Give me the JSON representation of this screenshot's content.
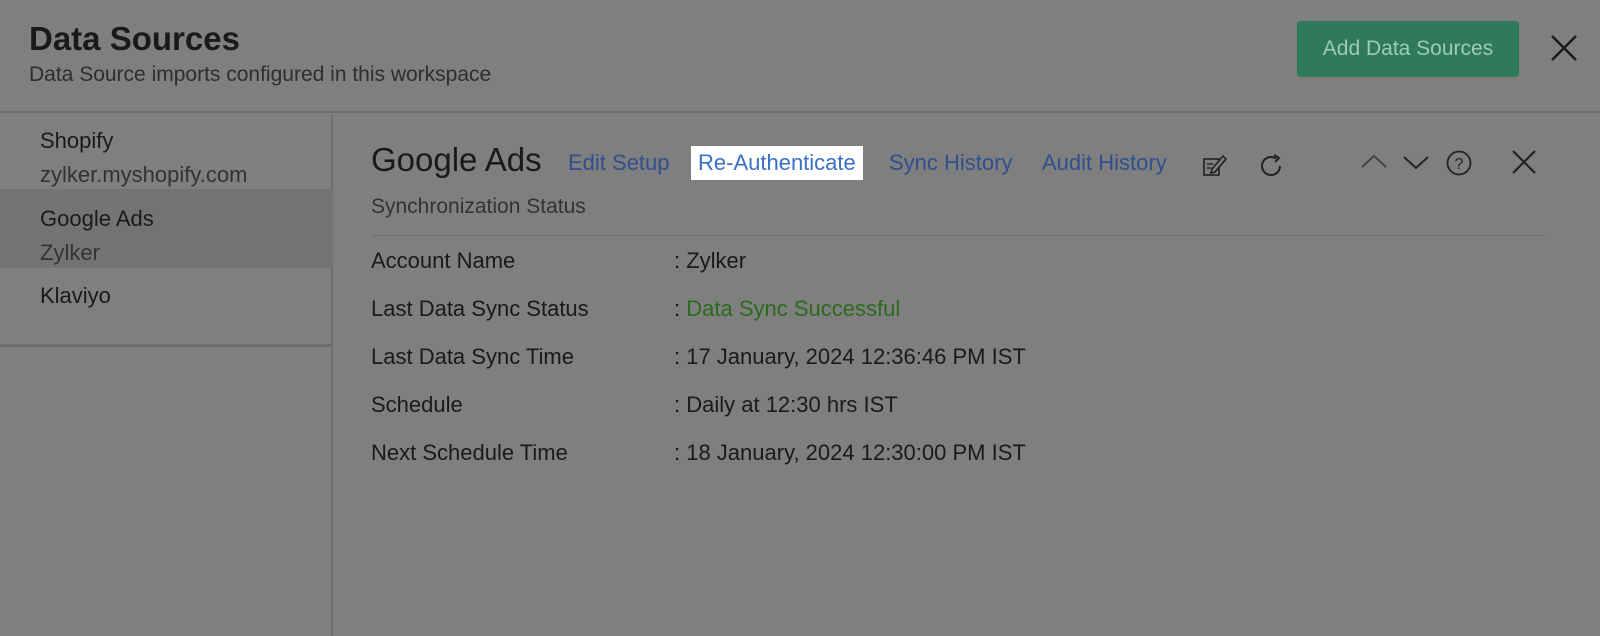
{
  "header": {
    "title": "Data Sources",
    "subtitle": "Data Source imports configured in this workspace",
    "add_button": "Add Data Sources"
  },
  "sidebar": {
    "items": [
      {
        "name": "Shopify",
        "sub": "zylker.myshopify.com"
      },
      {
        "name": "Google Ads",
        "sub": "Zylker",
        "active": true
      },
      {
        "name": "Klaviyo",
        "sub": ""
      }
    ]
  },
  "detail": {
    "title": "Google Ads",
    "links": {
      "edit_setup": "Edit Setup",
      "re_authenticate": "Re-Authenticate",
      "sync_history": "Sync History",
      "audit_history": "Audit History"
    },
    "icons": [
      "edit-icon",
      "refresh-icon",
      "chevron-up-icon",
      "chevron-down-icon",
      "help-icon",
      "close-icon"
    ],
    "section_label": "Synchronization Status",
    "rows": [
      {
        "label": "Account Name",
        "value": ": Zylker"
      },
      {
        "label": "Last Data Sync Status",
        "prefix": ": ",
        "value": "Data Sync Successful"
      },
      {
        "label": "Last Data Sync Time",
        "value": ": 17 January, 2024 12:36:46 PM IST"
      },
      {
        "label": "Schedule",
        "value": ": Daily at 12:30 hrs IST"
      },
      {
        "label": "Next Schedule Time",
        "value": ": 18 January, 2024 12:30:00 PM IST"
      }
    ]
  },
  "colors": {
    "overlay": "#7f7f7f",
    "primary_button": "#2f7a5a",
    "link": "#2f4f8f",
    "success": "#2b6b1c"
  }
}
